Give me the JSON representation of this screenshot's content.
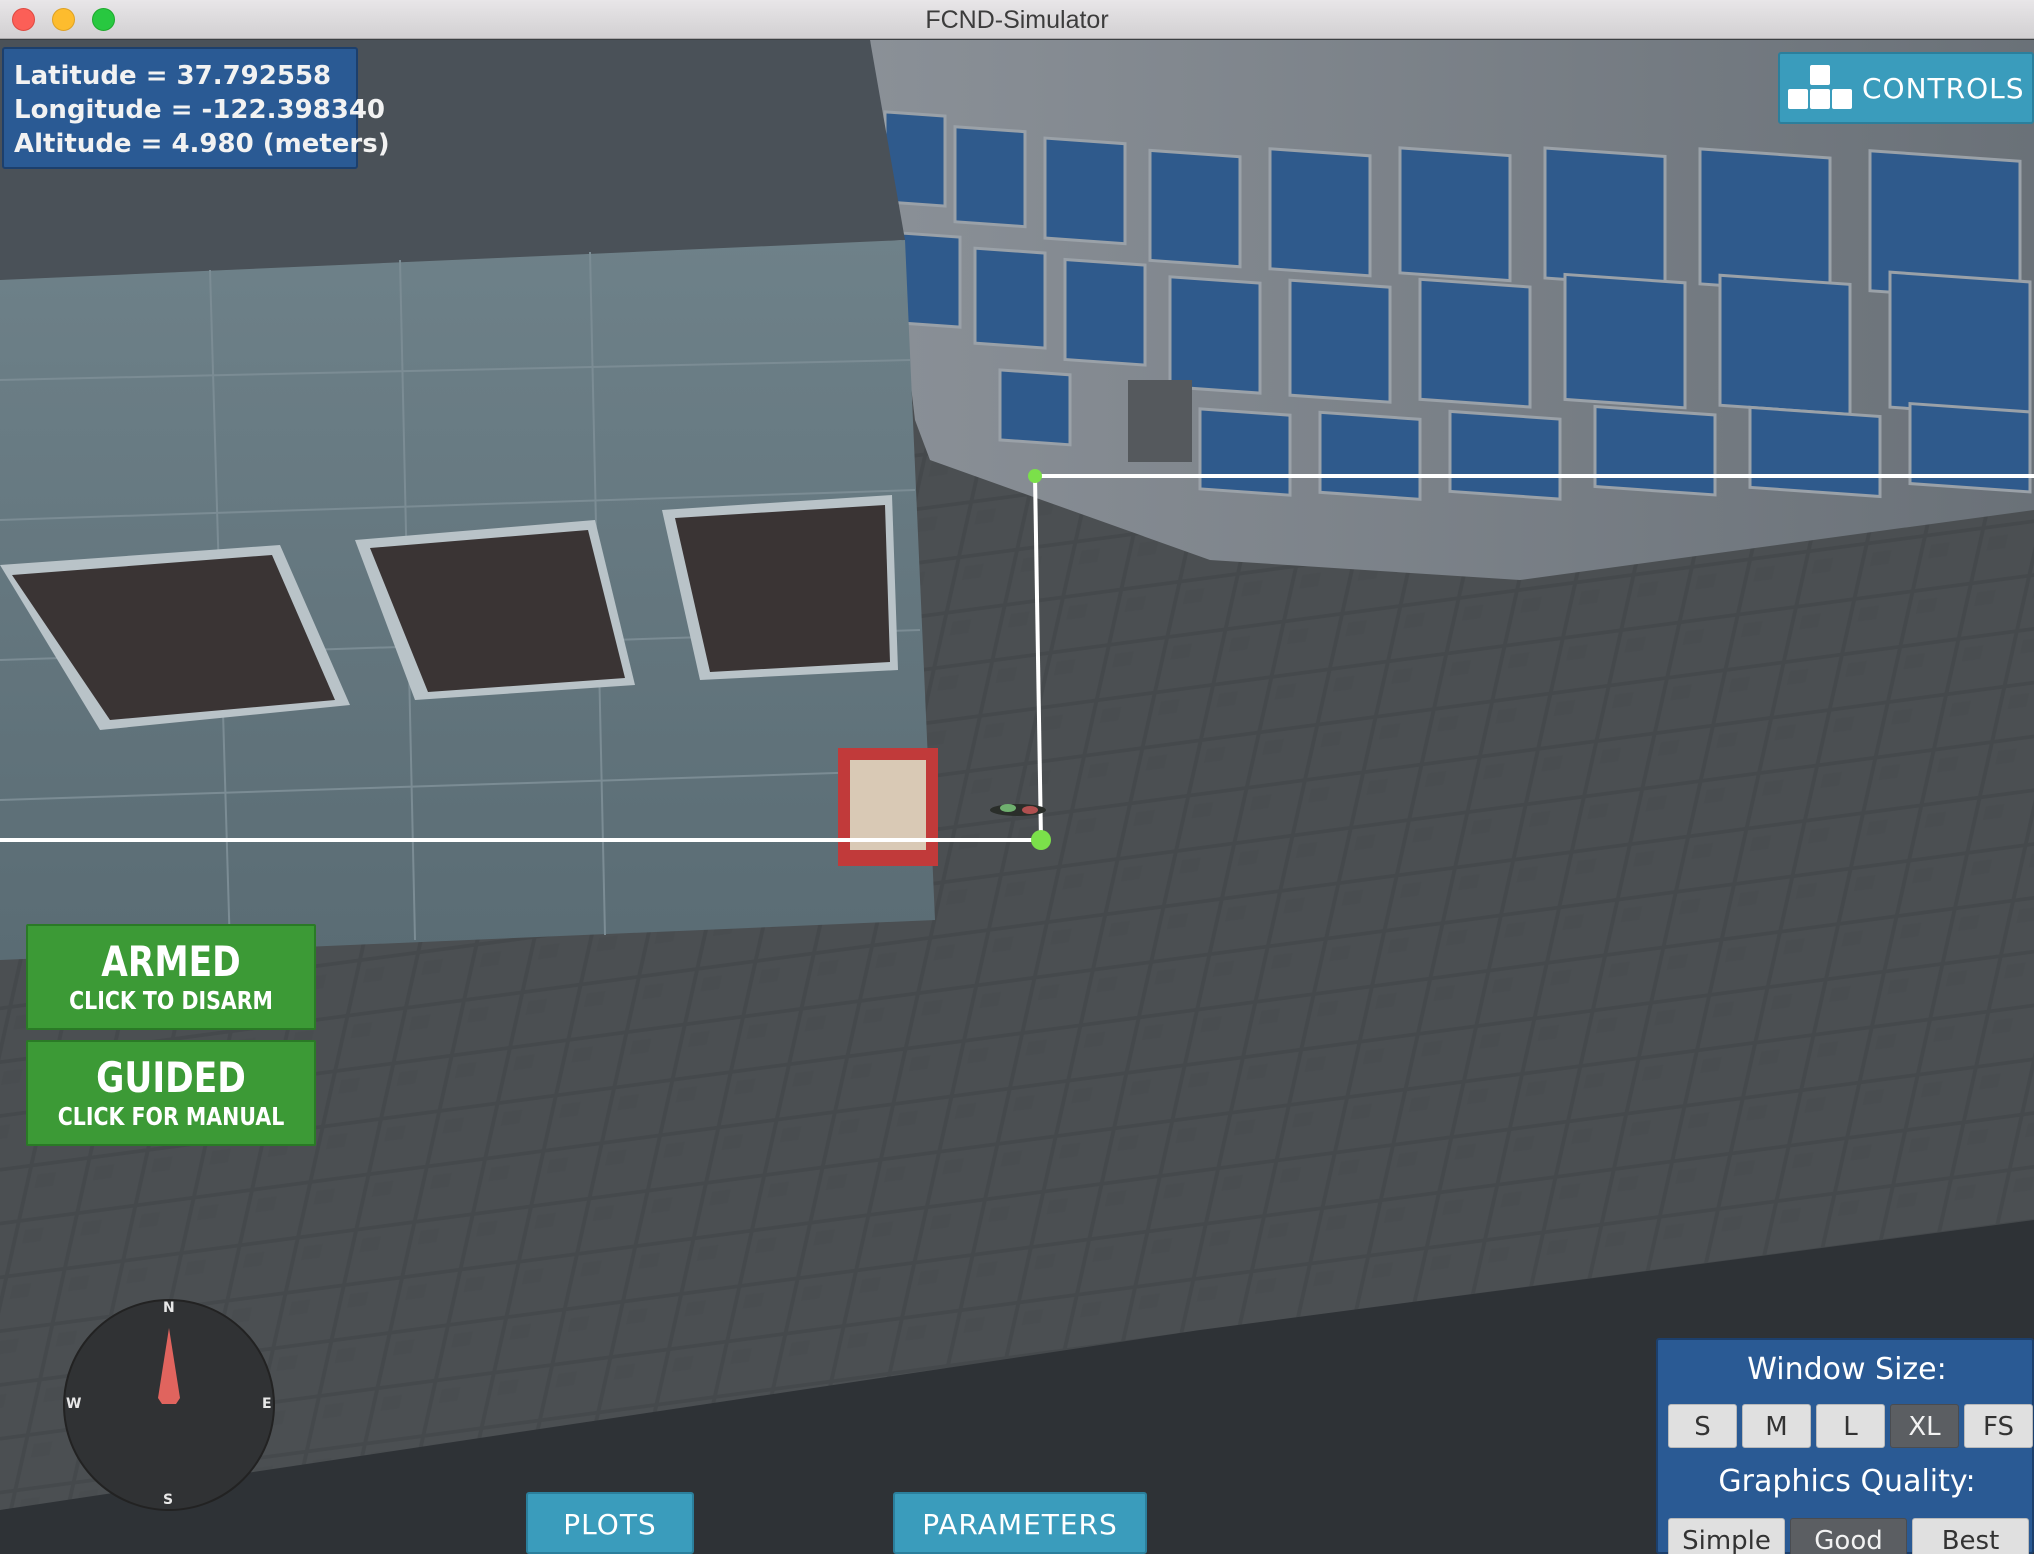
{
  "window": {
    "title": "FCND-Simulator"
  },
  "telemetry": {
    "latitude": "Latitude = 37.792558",
    "longitude": "Longitude = -122.398340",
    "altitude": "Altitude = 4.980 (meters)"
  },
  "controls": {
    "label": "CONTROLS"
  },
  "modes": {
    "armed_title": "ARMED",
    "armed_sub": "CLICK TO DISARM",
    "guided_title": "GUIDED",
    "guided_sub": "CLICK FOR MANUAL"
  },
  "compass": {
    "north": "N",
    "south": "S",
    "east": "E",
    "west": "W"
  },
  "bottom_buttons": {
    "plots": "PLOTS",
    "parameters": "PARAMETERS"
  },
  "settings": {
    "window_size_label": "Window Size:",
    "window_sizes": [
      "S",
      "M",
      "L",
      "XL",
      "FS"
    ],
    "window_size_selected": "XL",
    "graphics_quality_label": "Graphics Quality:",
    "graphics_qualities": [
      "Simple",
      "Good",
      "Best"
    ],
    "graphics_quality_selected": "Good"
  },
  "icons": {
    "controls": "keyboard-keys-icon",
    "compass_needle": "north-needle-icon"
  },
  "colors": {
    "panel_blue": "#2a5a94",
    "accent_teal": "#3a9cbc",
    "mode_green": "#3c9a36",
    "waypoint_green": "#7be04a",
    "compass_needle": "#e0645e"
  }
}
